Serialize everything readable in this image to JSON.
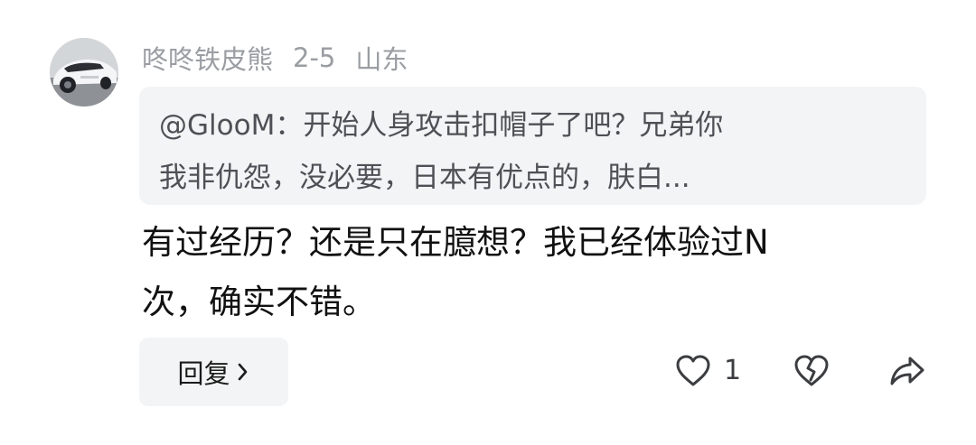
{
  "comment": {
    "author": "咚咚铁皮熊",
    "date": "2-5",
    "location": "山东",
    "avatar_icon": "car-avatar",
    "quote": {
      "line1": "@GlooM：开始人身攻击扣帽子了吧？兄弟你",
      "line2": "我非仇怨，没必要，日本有优点的，肤白..."
    },
    "text": {
      "line1": "有过经历？还是只在臆想？我已经体验过N",
      "line2": "次，确实不错。"
    },
    "reply_label": "回复",
    "like_count": "1",
    "icons": {
      "like": "heart-icon",
      "dislike": "broken-heart-icon",
      "share": "share-icon",
      "chevron": "chevron-right-icon"
    },
    "colors": {
      "meta_text": "#9a9da2",
      "quote_bg": "#f3f4f5",
      "body_text": "#111111"
    }
  }
}
